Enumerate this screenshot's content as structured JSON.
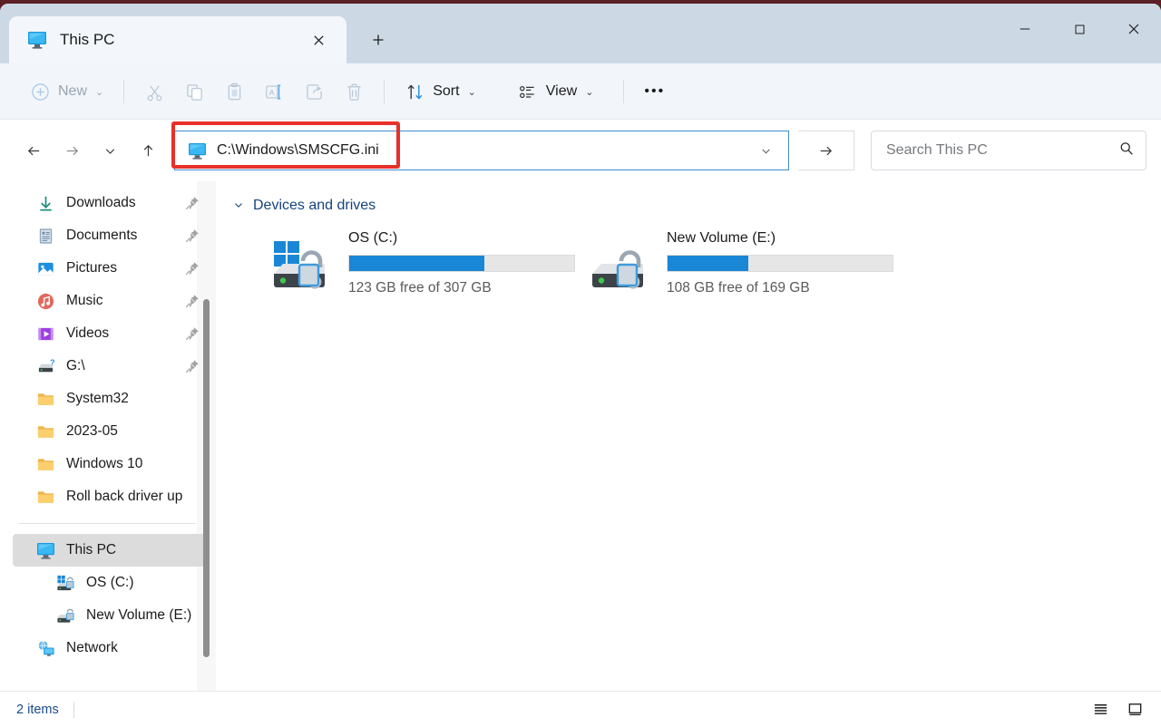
{
  "window": {
    "tab_title": "This PC",
    "tab_icon": "monitor-icon",
    "close_label": "✕",
    "newtab_label": "+",
    "minimize_label": "—",
    "maximize_label": "□",
    "winclose_label": "✕"
  },
  "toolbar": {
    "new_label": "New",
    "new_chevron": "⌄",
    "cut_label": "Cut",
    "copy_label": "Copy",
    "paste_label": "Paste",
    "rename_label": "Rename",
    "share_label": "Share",
    "delete_label": "Delete",
    "sort_label": "Sort",
    "sort_chevron": "⌄",
    "view_label": "View",
    "view_chevron": "⌄",
    "more_label": "•••"
  },
  "navigation": {
    "back_label": "←",
    "forward_label": "→",
    "recent_label": "⌄",
    "up_label": "↑",
    "address_value": "C:\\Windows\\SMSCFG.ini",
    "address_icon": "monitor-icon",
    "address_chevron": "⌄",
    "go_label": "→",
    "highlight_color": "#e8302a"
  },
  "search": {
    "placeholder": "Search This PC",
    "icon": "search-icon"
  },
  "sidebar": {
    "quick_access": [
      {
        "label": "Downloads",
        "icon": "downloads-icon",
        "pinned": true
      },
      {
        "label": "Documents",
        "icon": "documents-icon",
        "pinned": true
      },
      {
        "label": "Pictures",
        "icon": "pictures-icon",
        "pinned": true
      },
      {
        "label": "Music",
        "icon": "music-icon",
        "pinned": true
      },
      {
        "label": "Videos",
        "icon": "videos-icon",
        "pinned": true
      },
      {
        "label": "G:\\",
        "icon": "drive-unknown-icon",
        "pinned": true
      },
      {
        "label": "System32",
        "icon": "folder-icon",
        "pinned": false
      },
      {
        "label": "2023-05",
        "icon": "folder-icon",
        "pinned": false
      },
      {
        "label": "Windows 10",
        "icon": "folder-icon",
        "pinned": false
      },
      {
        "label": "Roll back driver up",
        "icon": "folder-icon",
        "pinned": false
      }
    ],
    "tree": [
      {
        "label": "This PC",
        "icon": "monitor-icon",
        "selected": true,
        "indent": 0
      },
      {
        "label": "OS (C:)",
        "icon": "os-drive-icon",
        "selected": false,
        "indent": 1
      },
      {
        "label": "New Volume (E:)",
        "icon": "drive-icon",
        "selected": false,
        "indent": 1
      },
      {
        "label": "Network",
        "icon": "network-icon",
        "selected": false,
        "indent": 0
      }
    ]
  },
  "content": {
    "group_label": "Devices and drives",
    "group_chevron": "⌄",
    "drives": [
      {
        "name": "OS (C:)",
        "free_text": "123 GB free of 307 GB",
        "used_percent": 60,
        "icon": "os-drive-icon",
        "bar_color": "#1a87d6"
      },
      {
        "name": "New Volume (E:)",
        "free_text": "108 GB free of 169 GB",
        "used_percent": 36,
        "icon": "drive-icon",
        "bar_color": "#1a87d6"
      }
    ]
  },
  "status": {
    "item_count": "2 items",
    "details_view_icon": "details-view-icon",
    "large_icons_view_icon": "large-icons-view-icon"
  }
}
